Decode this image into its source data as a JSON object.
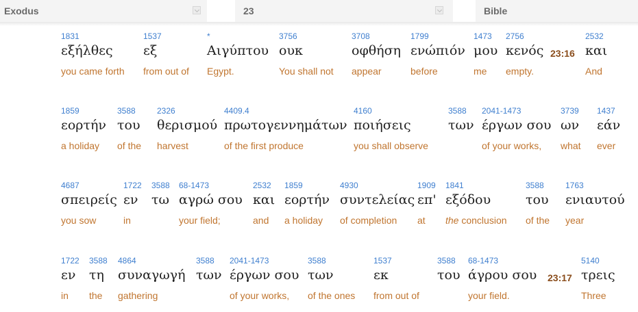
{
  "toolbar": {
    "book": "Exodus",
    "chapter": "23",
    "version": "Bible"
  },
  "rows": [
    [
      {
        "strong": "1831",
        "greek": "εξήλθες",
        "english": "you came forth"
      },
      {
        "strong": "1537",
        "greek": "εξ",
        "english": "from out of"
      },
      {
        "strong": "*",
        "greek": "Αιγύπτου",
        "english": "Egypt."
      },
      {
        "strong": "3756",
        "greek": "ουκ",
        "english": "You shall not"
      },
      {
        "strong": "3708",
        "greek": "οφθήση",
        "english": "appear"
      },
      {
        "strong": "1799",
        "greek": "ενώπιόν",
        "english": "before"
      },
      {
        "strong": "1473",
        "greek": "μου",
        "english": "me"
      },
      {
        "strong": "2756",
        "greek": "κενός",
        "english": "empty."
      },
      {
        "verse": "23:16"
      },
      {
        "strong": "2532",
        "greek": "και",
        "english": "And"
      }
    ],
    [
      {
        "strong": "1859",
        "greek": "εορτήν",
        "english": "a holiday"
      },
      {
        "strong": "3588",
        "greek": "του",
        "english": "of the"
      },
      {
        "strong": "2326",
        "greek": "θερισμού",
        "english": "harvest"
      },
      {
        "strong": "4409.4",
        "greek": "πρωτογεννημάτων",
        "english": "of the first produce"
      },
      {
        "strong": "4160",
        "greek": "ποιήσεις",
        "english": "you shall observe"
      },
      {
        "strong": "3588",
        "greek": "των",
        "english": ""
      },
      {
        "strong": "2041-1473",
        "greek": "έργων σου",
        "english": "of your works,"
      },
      {
        "strong": "3739",
        "greek": "ων",
        "english": "what"
      },
      {
        "strong": "1437",
        "greek": "εάν",
        "english": "ever"
      }
    ],
    [
      {
        "strong": "4687",
        "greek": "σπειρείς",
        "english": "you sow"
      },
      {
        "strong": "1722",
        "greek": "εν",
        "english": "in"
      },
      {
        "strong": "3588",
        "greek": "τω",
        "english": ""
      },
      {
        "strong": "68-1473",
        "greek": "αγρώ σου",
        "english": "your field;"
      },
      {
        "strong": "2532",
        "greek": "και",
        "english": "and"
      },
      {
        "strong": "1859",
        "greek": "εορτήν",
        "english": "a holiday"
      },
      {
        "strong": "4930",
        "greek": "συντελείας",
        "english": "of completion"
      },
      {
        "strong": "1909",
        "greek": "επ'",
        "english": "at"
      },
      {
        "strong": "1841",
        "greek": "εξόδου",
        "english_italic": "the",
        "english": " conclusion"
      },
      {
        "strong": "3588",
        "greek": "του",
        "english": "of the"
      },
      {
        "strong": "1763",
        "greek": "ενιαυτού",
        "english": "year"
      }
    ],
    [
      {
        "strong": "1722",
        "greek": "εν",
        "english": "in"
      },
      {
        "strong": "3588",
        "greek": "τη",
        "english": "the"
      },
      {
        "strong": "4864",
        "greek": "συναγωγή",
        "english": "gathering"
      },
      {
        "strong": "3588",
        "greek": "των",
        "english": ""
      },
      {
        "strong": "2041-1473",
        "greek": "έργων σου",
        "english": "of your works,"
      },
      {
        "strong": "3588",
        "greek": "των",
        "english": "of the ones"
      },
      {
        "strong": "1537",
        "greek": "εκ",
        "english": "from out of"
      },
      {
        "strong": "3588",
        "greek": "του",
        "english": ""
      },
      {
        "strong": "68-1473",
        "greek": "άγρου σου",
        "english": "your field."
      },
      {
        "verse": "23:17"
      },
      {
        "strong": "5140",
        "greek": "τρεις",
        "english": "Three"
      }
    ]
  ]
}
